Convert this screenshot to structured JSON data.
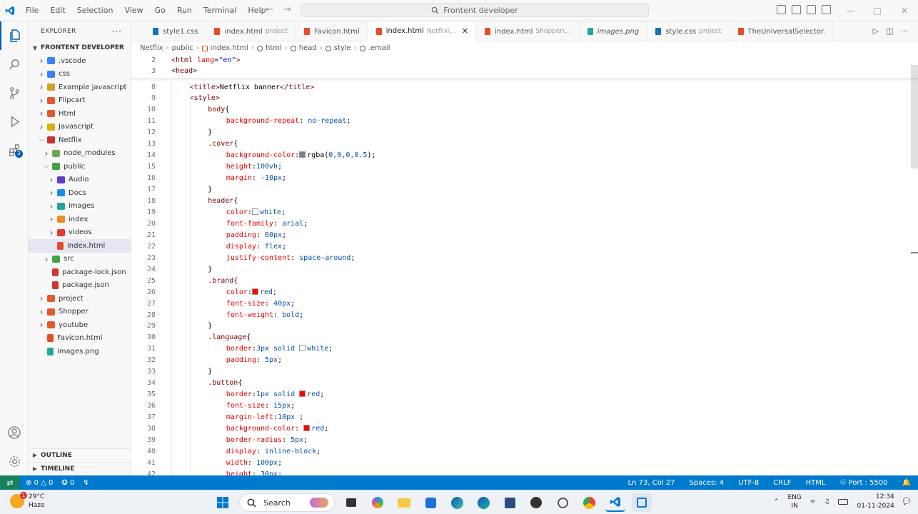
{
  "titlebar": {
    "menu": [
      "File",
      "Edit",
      "Selection",
      "View",
      "Go",
      "Run",
      "Terminal",
      "Help"
    ],
    "search_text": "Frontent developer"
  },
  "sidebar": {
    "title": "EXPLORER",
    "section": "FRONTENT DEVELOPER",
    "items": [
      {
        "label": ".vscode",
        "indent": 1,
        "type": "folder",
        "color": "#3b82f6",
        "open": false
      },
      {
        "label": "css",
        "indent": 1,
        "type": "folder",
        "color": "#3b82f6",
        "open": false
      },
      {
        "label": "Example javascript",
        "indent": 1,
        "type": "folder",
        "color": "#c9a227",
        "open": false
      },
      {
        "label": "Flipcart",
        "indent": 1,
        "type": "folder",
        "color": "#e25a2c",
        "open": false
      },
      {
        "label": "Html",
        "indent": 1,
        "type": "folder",
        "color": "#e25a2c",
        "open": false
      },
      {
        "label": "Javascript",
        "indent": 1,
        "type": "folder",
        "color": "#d4b106",
        "open": false
      },
      {
        "label": "Netflix",
        "indent": 1,
        "type": "folder",
        "color": "#c93030",
        "open": true
      },
      {
        "label": "node_modules",
        "indent": 2,
        "type": "folder",
        "color": "#6aa84f",
        "open": false
      },
      {
        "label": "public",
        "indent": 2,
        "type": "folder",
        "color": "#43a047",
        "open": true
      },
      {
        "label": "Audio",
        "indent": 3,
        "type": "folder",
        "color": "#5b3fc4",
        "open": false
      },
      {
        "label": "Docs",
        "indent": 3,
        "type": "folder",
        "color": "#1e88e5",
        "open": false
      },
      {
        "label": "images",
        "indent": 3,
        "type": "folder",
        "color": "#26a69a",
        "open": false
      },
      {
        "label": "index",
        "indent": 3,
        "type": "folder",
        "color": "#f08a24",
        "open": false
      },
      {
        "label": "videos",
        "indent": 3,
        "type": "folder",
        "color": "#e53935",
        "open": false
      },
      {
        "label": "index.html",
        "indent": 3,
        "type": "file",
        "color": "#e44d26",
        "open": false,
        "selected": true
      },
      {
        "label": "src",
        "indent": 2,
        "type": "folder",
        "color": "#43a047",
        "open": false
      },
      {
        "label": "package-lock.json",
        "indent": 2,
        "type": "file",
        "color": "#cb3837",
        "open": false
      },
      {
        "label": "package.json",
        "indent": 2,
        "type": "file",
        "color": "#cb3837",
        "open": false
      },
      {
        "label": "project",
        "indent": 1,
        "type": "folder",
        "color": "#e25a2c",
        "open": false
      },
      {
        "label": "Shopper",
        "indent": 1,
        "type": "folder",
        "color": "#e25a2c",
        "open": false
      },
      {
        "label": "youtube",
        "indent": 1,
        "type": "folder",
        "color": "#e25a2c",
        "open": false
      },
      {
        "label": "Favicon.html",
        "indent": 1,
        "type": "file",
        "color": "#e44d26",
        "open": false
      },
      {
        "label": "images.png",
        "indent": 1,
        "type": "file",
        "color": "#26a69a",
        "open": false
      }
    ],
    "outline": "OUTLINE",
    "timeline": "TIMELINE"
  },
  "tabs": [
    {
      "label": "style1.css",
      "desc": "",
      "icon": "css",
      "active": false,
      "italic": false
    },
    {
      "label": "index.html",
      "desc": "project",
      "icon": "html",
      "active": false,
      "italic": false
    },
    {
      "label": "Favicon.html",
      "desc": "",
      "icon": "html",
      "active": false,
      "italic": false
    },
    {
      "label": "index.html",
      "desc": "Netflix\\...",
      "icon": "html",
      "active": true,
      "italic": false
    },
    {
      "label": "index.html",
      "desc": "Shopper\\...",
      "icon": "html",
      "active": false,
      "italic": false
    },
    {
      "label": "images.png",
      "desc": "",
      "icon": "image",
      "active": false,
      "italic": true
    },
    {
      "label": "style.css",
      "desc": "project",
      "icon": "css",
      "active": false,
      "italic": false
    },
    {
      "label": "TheUniversalSelector.",
      "desc": "",
      "icon": "html",
      "active": false,
      "italic": false
    }
  ],
  "breadcrumb": [
    "Netflix",
    "public",
    "index.html",
    "html",
    "head",
    "style",
    ".email"
  ],
  "code": [
    {
      "n": "2",
      "indent": 0,
      "tokens": [
        [
          "tag",
          "<html "
        ],
        [
          "attr",
          "lang"
        ],
        [
          "punc",
          "="
        ],
        [
          "str",
          "\"en\""
        ],
        [
          "tag",
          ">"
        ]
      ]
    },
    {
      "n": "3",
      "indent": 0,
      "tokens": [
        [
          "tag",
          "<head>"
        ]
      ]
    },
    {
      "n": "8",
      "indent": 1,
      "tokens": [
        [
          "tag",
          "<title>"
        ],
        [
          "txt",
          "Netflix banner"
        ],
        [
          "tag",
          "</title>"
        ]
      ]
    },
    {
      "n": "9",
      "indent": 1,
      "tokens": [
        [
          "tag",
          "<style>"
        ]
      ]
    },
    {
      "n": "10",
      "indent": 2,
      "tokens": [
        [
          "sel",
          "body"
        ],
        [
          "punc",
          "{"
        ]
      ]
    },
    {
      "n": "11",
      "indent": 3,
      "tokens": [
        [
          "prop",
          "background-repeat"
        ],
        [
          "punc",
          ": "
        ],
        [
          "val",
          "no-repeat"
        ],
        [
          "punc",
          ";"
        ]
      ]
    },
    {
      "n": "12",
      "indent": 2,
      "tokens": [
        [
          "punc",
          "}"
        ]
      ]
    },
    {
      "n": "13",
      "indent": 2,
      "tokens": [
        [
          "sel",
          ".cover"
        ],
        [
          "punc",
          "{"
        ]
      ]
    },
    {
      "n": "14",
      "indent": 3,
      "tokens": [
        [
          "prop",
          "background-color"
        ],
        [
          "punc",
          ":"
        ],
        [
          "swatch",
          "rgba(0,0,0,0.5)"
        ],
        [
          "punc",
          "rgba("
        ],
        [
          "val",
          "0,0,0,0.5"
        ],
        [
          "punc",
          ");"
        ]
      ]
    },
    {
      "n": "15",
      "indent": 3,
      "tokens": [
        [
          "prop",
          "height"
        ],
        [
          "punc",
          ":"
        ],
        [
          "val",
          "100vh"
        ],
        [
          "punc",
          ";"
        ]
      ]
    },
    {
      "n": "16",
      "indent": 3,
      "tokens": [
        [
          "prop",
          "margin"
        ],
        [
          "punc",
          ": "
        ],
        [
          "val",
          "-10px"
        ],
        [
          "punc",
          ";"
        ]
      ]
    },
    {
      "n": "17",
      "indent": 2,
      "tokens": [
        [
          "punc",
          "}"
        ]
      ]
    },
    {
      "n": "18",
      "indent": 2,
      "tokens": [
        [
          "sel",
          "header"
        ],
        [
          "punc",
          "{"
        ]
      ]
    },
    {
      "n": "19",
      "indent": 3,
      "tokens": [
        [
          "prop",
          "color"
        ],
        [
          "punc",
          ":"
        ],
        [
          "swatch",
          "#ffffff"
        ],
        [
          "val",
          "white"
        ],
        [
          "punc",
          ";"
        ]
      ]
    },
    {
      "n": "20",
      "indent": 3,
      "tokens": [
        [
          "prop",
          "font-family"
        ],
        [
          "punc",
          ": "
        ],
        [
          "val",
          "arial"
        ],
        [
          "punc",
          ";"
        ]
      ]
    },
    {
      "n": "21",
      "indent": 3,
      "tokens": [
        [
          "prop",
          "padding"
        ],
        [
          "punc",
          ": "
        ],
        [
          "val",
          "60px"
        ],
        [
          "punc",
          ";"
        ]
      ]
    },
    {
      "n": "22",
      "indent": 3,
      "tokens": [
        [
          "prop",
          "display"
        ],
        [
          "punc",
          ": "
        ],
        [
          "val",
          "flex"
        ],
        [
          "punc",
          ";"
        ]
      ]
    },
    {
      "n": "23",
      "indent": 3,
      "tokens": [
        [
          "prop",
          "justify-content"
        ],
        [
          "punc",
          ": "
        ],
        [
          "val",
          "space-around"
        ],
        [
          "punc",
          ";"
        ]
      ]
    },
    {
      "n": "24",
      "indent": 2,
      "tokens": [
        [
          "punc",
          "}"
        ]
      ]
    },
    {
      "n": "25",
      "indent": 2,
      "tokens": [
        [
          "sel",
          ".brand"
        ],
        [
          "punc",
          "{"
        ]
      ]
    },
    {
      "n": "26",
      "indent": 3,
      "tokens": [
        [
          "prop",
          "color"
        ],
        [
          "punc",
          ":"
        ],
        [
          "swatch",
          "#ff0000"
        ],
        [
          "val",
          "red"
        ],
        [
          "punc",
          ";"
        ]
      ]
    },
    {
      "n": "27",
      "indent": 3,
      "tokens": [
        [
          "prop",
          "font-size"
        ],
        [
          "punc",
          ": "
        ],
        [
          "val",
          "40px"
        ],
        [
          "punc",
          ";"
        ]
      ]
    },
    {
      "n": "28",
      "indent": 3,
      "tokens": [
        [
          "prop",
          "font-weight"
        ],
        [
          "punc",
          ": "
        ],
        [
          "val",
          "bold"
        ],
        [
          "punc",
          ";"
        ]
      ]
    },
    {
      "n": "29",
      "indent": 2,
      "tokens": [
        [
          "punc",
          "}"
        ]
      ]
    },
    {
      "n": "30",
      "indent": 2,
      "tokens": [
        [
          "sel",
          ".language"
        ],
        [
          "punc",
          "{"
        ]
      ]
    },
    {
      "n": "31",
      "indent": 3,
      "tokens": [
        [
          "prop",
          "border"
        ],
        [
          "punc",
          ":"
        ],
        [
          "val",
          "3px solid "
        ],
        [
          "swatch",
          "#ffffff"
        ],
        [
          "val",
          "white"
        ],
        [
          "punc",
          ";"
        ]
      ]
    },
    {
      "n": "32",
      "indent": 3,
      "tokens": [
        [
          "prop",
          "padding"
        ],
        [
          "punc",
          ": "
        ],
        [
          "val",
          "5px"
        ],
        [
          "punc",
          ";"
        ]
      ]
    },
    {
      "n": "33",
      "indent": 2,
      "tokens": [
        [
          "punc",
          "}"
        ]
      ]
    },
    {
      "n": "34",
      "indent": 2,
      "tokens": [
        [
          "sel",
          ".button"
        ],
        [
          "punc",
          "{"
        ]
      ]
    },
    {
      "n": "35",
      "indent": 3,
      "tokens": [
        [
          "prop",
          "border"
        ],
        [
          "punc",
          ":"
        ],
        [
          "val",
          "1px solid "
        ],
        [
          "swatch",
          "#ff0000"
        ],
        [
          "val",
          "red"
        ],
        [
          "punc",
          ";"
        ]
      ]
    },
    {
      "n": "36",
      "indent": 3,
      "tokens": [
        [
          "prop",
          "font-size"
        ],
        [
          "punc",
          ": "
        ],
        [
          "val",
          "15px"
        ],
        [
          "punc",
          ";"
        ]
      ]
    },
    {
      "n": "37",
      "indent": 3,
      "tokens": [
        [
          "prop",
          "margin-left"
        ],
        [
          "punc",
          ":"
        ],
        [
          "val",
          "10px"
        ],
        [
          "punc",
          " ;"
        ]
      ]
    },
    {
      "n": "38",
      "indent": 3,
      "tokens": [
        [
          "prop",
          "background-color"
        ],
        [
          "punc",
          ": "
        ],
        [
          "swatch",
          "#ff0000"
        ],
        [
          "val",
          "red"
        ],
        [
          "punc",
          ";"
        ]
      ]
    },
    {
      "n": "39",
      "indent": 3,
      "tokens": [
        [
          "prop",
          "border-radius"
        ],
        [
          "punc",
          ": "
        ],
        [
          "val",
          "5px"
        ],
        [
          "punc",
          ";"
        ]
      ]
    },
    {
      "n": "40",
      "indent": 3,
      "tokens": [
        [
          "prop",
          "display"
        ],
        [
          "punc",
          ": "
        ],
        [
          "val",
          "inline-block"
        ],
        [
          "punc",
          ";"
        ]
      ]
    },
    {
      "n": "41",
      "indent": 3,
      "tokens": [
        [
          "prop",
          "width"
        ],
        [
          "punc",
          ": "
        ],
        [
          "val",
          "100px"
        ],
        [
          "punc",
          ";"
        ]
      ]
    },
    {
      "n": "42",
      "indent": 3,
      "tokens": [
        [
          "prop",
          "height"
        ],
        [
          "punc",
          ": "
        ],
        [
          "val",
          "30px"
        ],
        [
          "punc",
          ";"
        ]
      ]
    }
  ],
  "statusbar": {
    "errors": "0",
    "warnings": "0",
    "ports": "0",
    "position": "Ln 73, Col 27",
    "spaces": "Spaces: 4",
    "encoding": "UTF-8",
    "eol": "CRLF",
    "language": "HTML",
    "port": "Port : 5500"
  },
  "taskbar": {
    "weather_temp": "29°C",
    "weather_desc": "Haze",
    "weather_badge": "1",
    "search_label": "Search",
    "lang": "ENG",
    "region": "IN",
    "time": "12:34",
    "date": "01-11-2024"
  },
  "colors": {
    "accent": "#007acc",
    "remote": "#16825d",
    "activity_active": "#005fb8"
  }
}
